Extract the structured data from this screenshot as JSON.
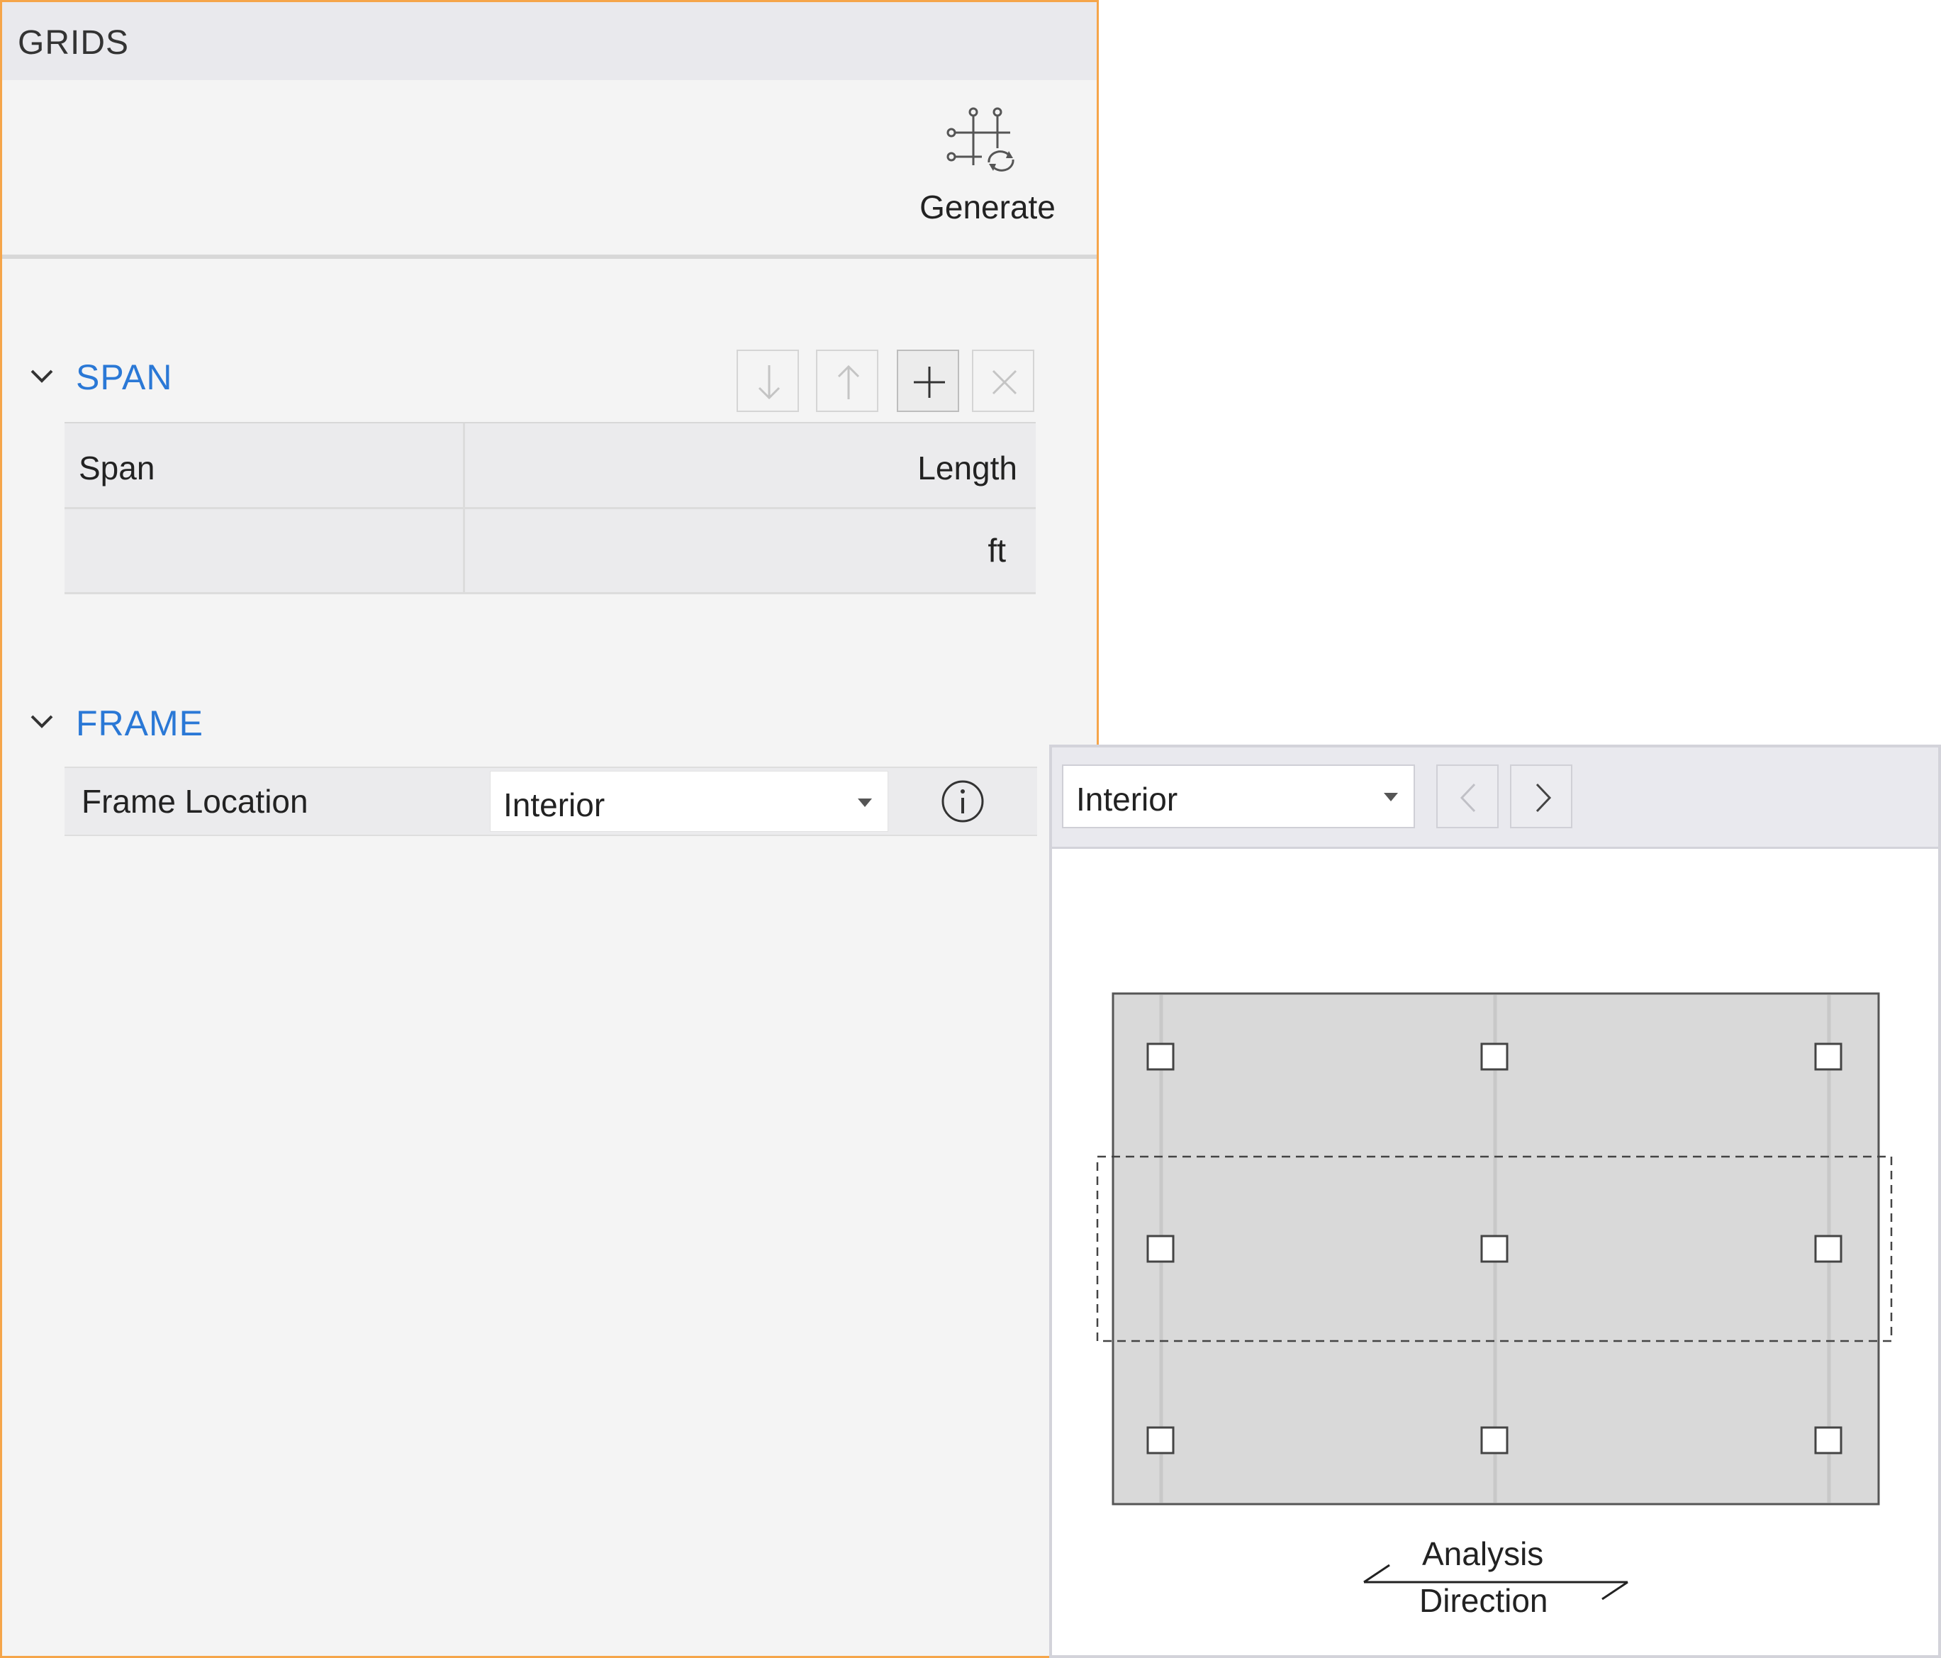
{
  "panel": {
    "title": "GRIDS",
    "toolbar": {
      "generate_label": "Generate",
      "generate_icon": "grid-generate-icon"
    },
    "accent_color": "#2a78d6",
    "border_color": "#f5a54a"
  },
  "span_section": {
    "title": "SPAN",
    "buttons": [
      {
        "icon": "arrow-down-icon",
        "enabled": false
      },
      {
        "icon": "arrow-up-icon",
        "enabled": false
      },
      {
        "icon": "plus-icon",
        "enabled": true
      },
      {
        "icon": "close-icon",
        "enabled": false
      }
    ],
    "table": {
      "columns": [
        "Span",
        "Length"
      ],
      "units": [
        "",
        "ft"
      ]
    }
  },
  "frame_section": {
    "title": "FRAME",
    "frame_location_label": "Frame Location",
    "frame_location_value": "Interior",
    "info_icon": "info-icon"
  },
  "preview": {
    "selected": "Interior",
    "prev_icon": "chevron-left-icon",
    "next_icon": "chevron-right-icon",
    "diagram": {
      "columns": 3,
      "rows": 3,
      "highlighted_row": 2
    },
    "analysis_label": "Analysis",
    "direction_label": "Direction"
  }
}
